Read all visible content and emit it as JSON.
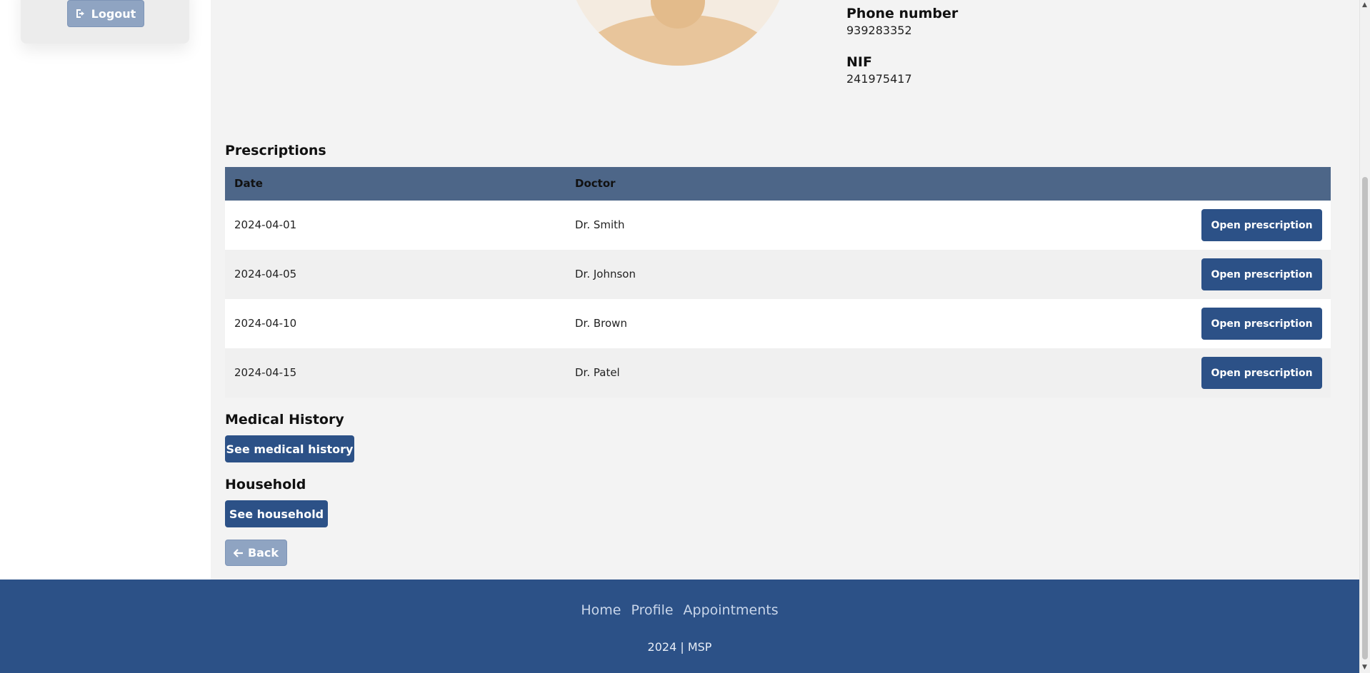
{
  "sidebar": {
    "logout_label": "Logout"
  },
  "profile": {
    "phone_label": "Phone number",
    "phone_value": "939283352",
    "nif_label": "NIF",
    "nif_value": "241975417"
  },
  "prescriptions": {
    "title": "Prescriptions",
    "columns": [
      "Date",
      "Doctor"
    ],
    "rows": [
      {
        "date": "2024-04-01",
        "doctor": "Dr. Smith",
        "action": "Open prescription"
      },
      {
        "date": "2024-04-05",
        "doctor": "Dr. Johnson",
        "action": "Open prescription"
      },
      {
        "date": "2024-04-10",
        "doctor": "Dr. Brown",
        "action": "Open prescription"
      },
      {
        "date": "2024-04-15",
        "doctor": "Dr. Patel",
        "action": "Open prescription"
      }
    ]
  },
  "medical_history": {
    "title": "Medical History",
    "button": "See medical history"
  },
  "household": {
    "title": "Household",
    "button": "See household"
  },
  "back_label": "Back",
  "footer": {
    "links": [
      "Home",
      "Profile",
      "Appointments"
    ],
    "copyright": "2024 | MSP"
  },
  "colors": {
    "primary": "#2c5187",
    "table_header": "#4d6688",
    "muted_button": "#8fa4c2"
  },
  "icons": {
    "logout": "sign-out-icon",
    "back": "arrow-left-icon"
  }
}
